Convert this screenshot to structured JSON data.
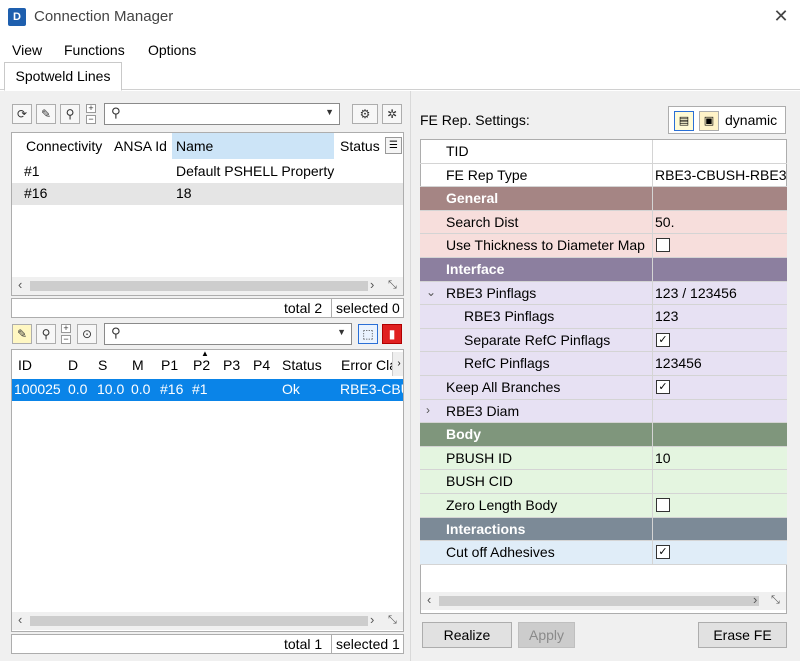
{
  "window": {
    "title": "Connection Manager",
    "app_icon": "ansa-logo"
  },
  "menu": [
    "View",
    "Functions",
    "Options"
  ],
  "tabs": [
    {
      "label": "Spotweld Lines",
      "active": true
    }
  ],
  "top_table": {
    "columns": [
      "Connectivity",
      "ANSA Id",
      "Name",
      "Status"
    ],
    "rows": [
      {
        "connectivity": "#1",
        "ansa_id": "",
        "name": "Default PSHELL Property",
        "status": ""
      },
      {
        "connectivity": "#16",
        "ansa_id": "",
        "name": "18",
        "status": ""
      }
    ],
    "footer": {
      "total": "total 2",
      "selected": "selected 0"
    }
  },
  "bottom_table": {
    "columns": [
      "ID",
      "D",
      "S",
      "M",
      "P1",
      "P2",
      "P3",
      "P4",
      "Status",
      "Error Cla"
    ],
    "rows": [
      {
        "id": "100025",
        "d": "0.0",
        "s": "10.0",
        "m": "0.0",
        "p1": "#16",
        "p2": "#1",
        "p3": "",
        "p4": "",
        "status": "Ok",
        "error": "RBE3-CBU"
      }
    ],
    "footer": {
      "total": "total 1",
      "selected": "selected 1"
    }
  },
  "fe_settings": {
    "label": "FE Rep. Settings:",
    "mode_label": "dynamic",
    "rows": [
      {
        "name": "TID",
        "value": ""
      },
      {
        "name": "FE Rep Type",
        "value": "RBE3-CBUSH-RBE3"
      },
      {
        "name": "General",
        "section": true
      },
      {
        "name": "Search Dist",
        "value": "50."
      },
      {
        "name": "Use Thickness to Diameter Map",
        "checkbox": false
      },
      {
        "name": "Interface",
        "section": true
      },
      {
        "name": "RBE3 Pinflags",
        "value": "123 / 123456",
        "expander": "expanded"
      },
      {
        "name": "RBE3 Pinflags",
        "value": "123",
        "indent": true
      },
      {
        "name": "Separate RefC Pinflags",
        "checkbox": true,
        "indent": true
      },
      {
        "name": "RefC Pinflags",
        "value": "123456",
        "indent": true
      },
      {
        "name": "Keep All Branches",
        "checkbox": true
      },
      {
        "name": "RBE3 Diam",
        "value": "",
        "expander": "collapsed"
      },
      {
        "name": "Body",
        "section": true
      },
      {
        "name": "PBUSH ID",
        "value": "10"
      },
      {
        "name": "BUSH CID",
        "value": ""
      },
      {
        "name": "Zero Length Body",
        "checkbox": false
      },
      {
        "name": "Interactions",
        "section": true
      },
      {
        "name": "Cut off Adhesives",
        "checkbox": true
      }
    ]
  },
  "buttons": {
    "realize": "Realize",
    "apply": "Apply",
    "erase_fe": "Erase FE"
  },
  "colors": {
    "selection": "#0a84e8",
    "header_highlight": "#cce4f7",
    "general_section": "#a58584",
    "general_rows": "#f7dedc",
    "interface_section": "#8c7f9f",
    "interface_rows": "#e7e1f3",
    "body_section": "#7f967c",
    "body_rows": "#e4f5e0",
    "interactions_section": "#7c8a97",
    "interactions_rows": "#e0edf8"
  }
}
